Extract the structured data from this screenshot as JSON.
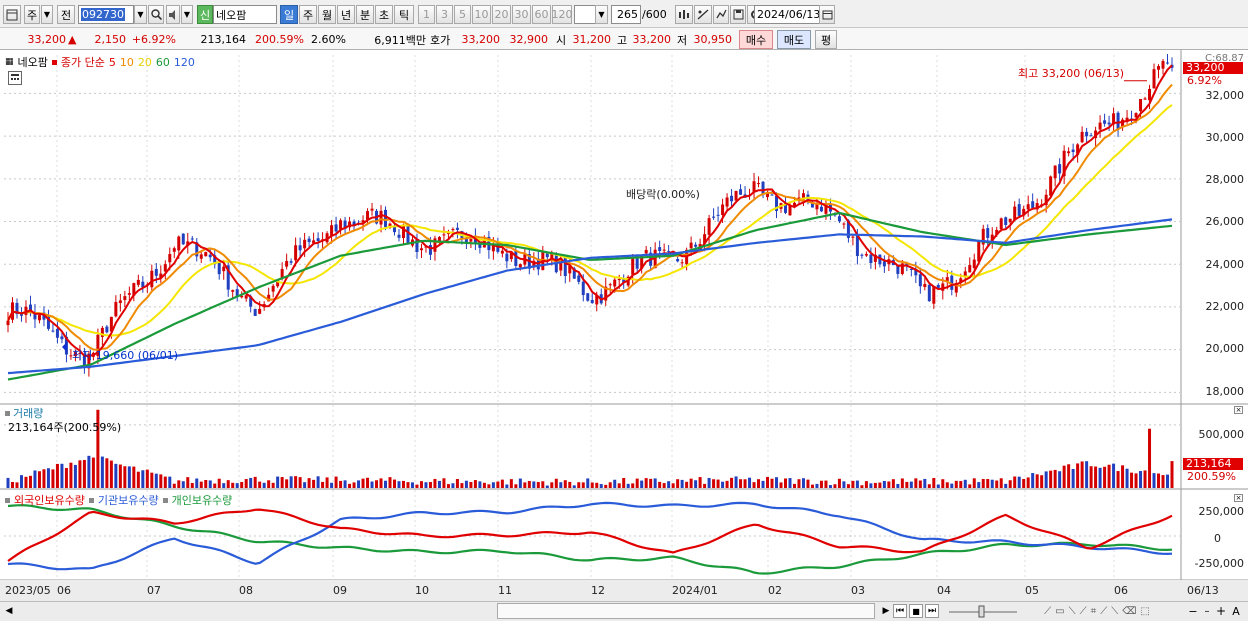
{
  "toolbar": {
    "period_type": "주",
    "market": "전",
    "stock_code": "092730",
    "sin_badge": "신",
    "stock_name": "네오팜",
    "periods": [
      "일",
      "주",
      "월",
      "년",
      "분",
      "초",
      "틱"
    ],
    "selected_period": "일",
    "minute_options": [
      "1",
      "3",
      "5",
      "10",
      "20",
      "30",
      "60",
      "120"
    ],
    "count": "265",
    "count_max": "/600",
    "date": "2024/06/13"
  },
  "quote": {
    "price": "33,200",
    "change_arrow": "▲",
    "change": "2,150",
    "change_pct": "+6.92%",
    "volume": "213,164",
    "volume_ratio": "200.59%",
    "turnover": "2.60%",
    "amount": "6,911백만",
    "hoga_label": "호가",
    "ask": "33,200",
    "bid": "32,900",
    "open_label": "시",
    "open": "31,200",
    "high_label": "고",
    "high": "33,200",
    "low_label": "저",
    "low": "30,950",
    "buy_button": "매수",
    "sell_button": "매도",
    "avg_button": "평"
  },
  "price_panel": {
    "legend_name": "네오팜",
    "legend_ma_title": "종가 단순",
    "ma_periods": [
      "5",
      "10",
      "20",
      "60",
      "120"
    ],
    "ma_colors": [
      "#e00000",
      "#f08a00",
      "#f4e600",
      "#1a9a3a",
      "#2a5bd8"
    ],
    "high_annotation": "최고 33,200 (06/13)",
    "low_annotation": "최저 19,660 (06/01)",
    "dividend_annotation": "배당락(0.00%)",
    "current_price_tag": "33,200",
    "current_pct_tag": "6.92%",
    "top_label": "C:68.87",
    "y_ticks": [
      "32,000",
      "30,000",
      "28,000",
      "26,000",
      "24,000",
      "22,000",
      "20,000",
      "18,000"
    ]
  },
  "volume_panel": {
    "title": "거래량",
    "subtitle": "213,164주(200.59%)",
    "y_tick": "500,000",
    "current_tag": "213,164",
    "current_pct_tag": "200.59%"
  },
  "holding_panel": {
    "series": [
      "외국인보유수량",
      "기관보유수량",
      "개인보유수량"
    ],
    "series_colors": [
      "#e00000",
      "#2a5bd8",
      "#1a9a3a"
    ],
    "y_ticks": [
      "250,000",
      "0",
      "-250,000"
    ]
  },
  "x_axis": [
    "2023/05",
    "06",
    "07",
    "08",
    "09",
    "10",
    "11",
    "12",
    "2024/01",
    "02",
    "03",
    "04",
    "05",
    "06"
  ],
  "x_axis_right": "06/13",
  "chart_data": {
    "type": "candlestick",
    "title": "네오팜",
    "x": [
      "2023/05",
      "06",
      "07",
      "08",
      "09",
      "10",
      "11",
      "12",
      "2024/01",
      "02",
      "03",
      "04",
      "05",
      "06",
      "06/13"
    ],
    "close": [
      21800,
      19800,
      25200,
      22200,
      26300,
      25200,
      24800,
      22800,
      24400,
      27600,
      26000,
      22500,
      25800,
      30000,
      33200
    ],
    "ma120": [
      18900,
      19200,
      19700,
      20200,
      21300,
      22600,
      23700,
      24300,
      24500,
      25000,
      25400,
      25300,
      25000,
      25600,
      26100
    ],
    "ma60": [
      18600,
      19300,
      21200,
      22900,
      24400,
      25100,
      24900,
      24200,
      24400,
      25600,
      26400,
      25500,
      24900,
      25400,
      25800
    ],
    "ylim": [
      17500,
      33800
    ],
    "high_point": {
      "date": "06/13",
      "value": 33200
    },
    "low_point": {
      "date": "06/01",
      "value": 19660
    },
    "volume": [
      60000,
      620000,
      80000,
      110000,
      90000,
      70000,
      60000,
      50000,
      70000,
      100000,
      60000,
      60000,
      70000,
      470000,
      213164
    ],
    "foreign_holding": [
      -250000,
      230000,
      130000,
      280000,
      70000,
      0,
      10000,
      40000,
      -180000,
      120000,
      -100000,
      -160000,
      200000,
      -120000,
      210000
    ],
    "institution_holding": [
      -280000,
      -340000,
      -20000,
      -270000,
      160000,
      230000,
      240000,
      320000,
      300000,
      320000,
      210000,
      -40000,
      -60000,
      -110000,
      -170000
    ],
    "individual_holding": [
      300000,
      260000,
      100000,
      -50000,
      -120000,
      -160000,
      -150000,
      -240000,
      -220000,
      -370000,
      -300000,
      -180000,
      -90000,
      -80000,
      -130000
    ]
  }
}
